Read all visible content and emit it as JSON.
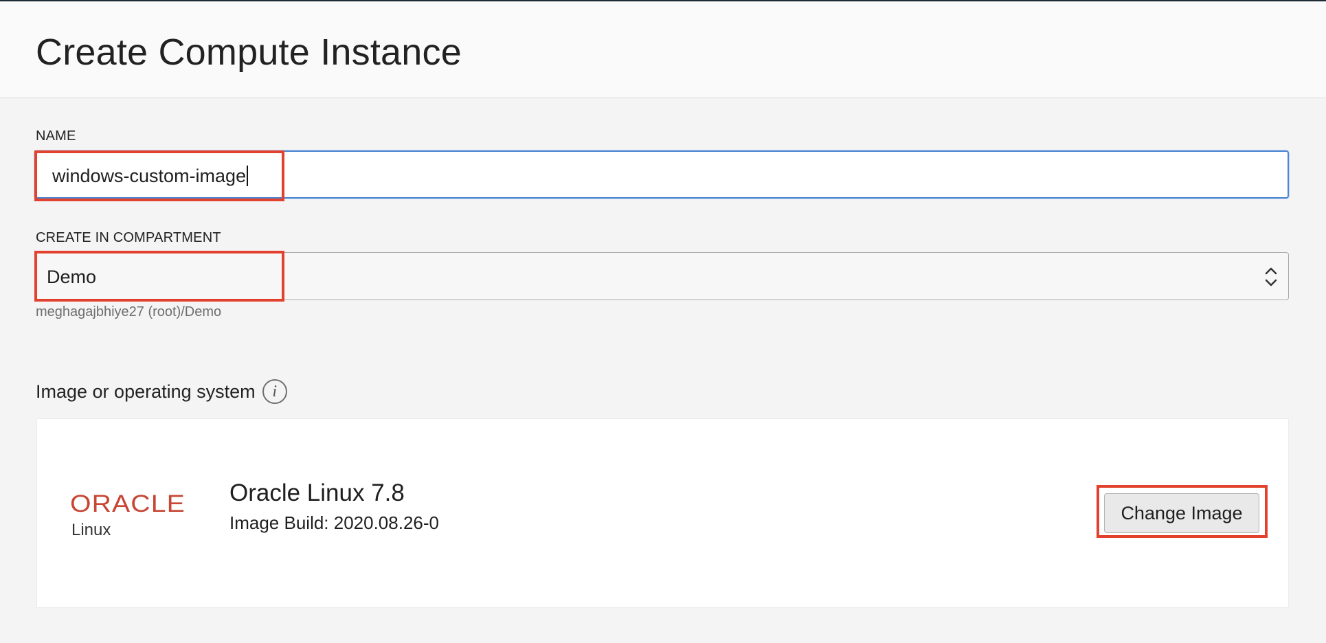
{
  "header": {
    "title": "Create Compute Instance"
  },
  "form": {
    "name_label": "NAME",
    "name_value": "windows-custom-image",
    "compartment_label": "CREATE IN COMPARTMENT",
    "compartment_value": "Demo",
    "compartment_path": "meghagajbhiye27 (root)/Demo"
  },
  "image_section": {
    "title": "Image or operating system",
    "info_icon_glyph": "i",
    "logo_wordmark": "ORACLE",
    "logo_subtitle": "Linux",
    "os_name": "Oracle Linux 7.8",
    "build": "Image Build: 2020.08.26-0",
    "change_button_label": "Change Image"
  },
  "icons": {
    "info": "info-icon",
    "select_chevrons": "chevron-up-down-icon"
  },
  "colors": {
    "highlight": "#e2412d",
    "focus_border": "#4b86d1",
    "oracle_red": "#c74634"
  }
}
